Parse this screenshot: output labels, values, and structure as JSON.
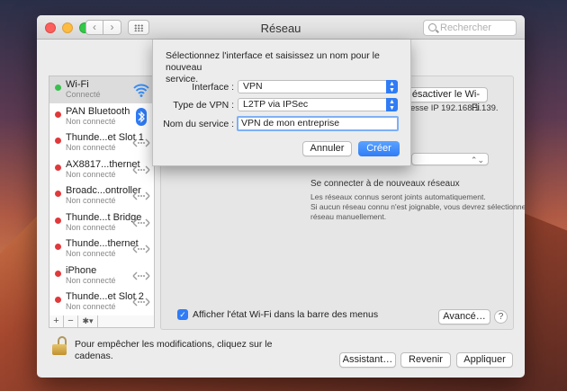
{
  "window": {
    "title": "Réseau",
    "search_placeholder": "Rechercher",
    "nav_back": "‹",
    "nav_forward": "›"
  },
  "sidebar": {
    "items": [
      {
        "name": "Wi-Fi",
        "status": "Connecté",
        "dot": "green",
        "icon": "wifi-icon"
      },
      {
        "name": "PAN Bluetooth",
        "status": "Non connecté",
        "dot": "red",
        "icon": "bluetooth-icon"
      },
      {
        "name": "Thunde...et Slot 1",
        "status": "Non connecté",
        "dot": "red",
        "icon": "ethernet-icon"
      },
      {
        "name": "AX8817...thernet",
        "status": "Non connecté",
        "dot": "red",
        "icon": "ethernet-icon"
      },
      {
        "name": "Broadc...ontroller",
        "status": "Non connecté",
        "dot": "red",
        "icon": "ethernet-icon"
      },
      {
        "name": "Thunde...t Bridge",
        "status": "Non connecté",
        "dot": "red",
        "icon": "ethernet-icon"
      },
      {
        "name": "Thunde...thernet",
        "status": "Non connecté",
        "dot": "red",
        "icon": "ethernet-icon"
      },
      {
        "name": "iPhone",
        "status": "Non connecté",
        "dot": "red",
        "icon": "ethernet-icon"
      },
      {
        "name": "Thunde...et Slot 2",
        "status": "Non connecté",
        "dot": "red",
        "icon": "ethernet-icon"
      }
    ],
    "add_label": "+",
    "remove_label": "−",
    "action_label": "✱▾"
  },
  "pane": {
    "disable_wifi_label": "ésactiver le Wi-Fi",
    "ip_text": "esse IP 192.168.1.139.",
    "ask_join_label": "Se connecter à de nouveaux réseaux",
    "auto_join_help": "Les réseaux connus seront joints automatiquement.",
    "no_network_help_1": "Si aucun réseau connu n'est joignable, vous devrez sélectionner un",
    "no_network_help_2": "réseau manuellement.",
    "show_status_label": "Afficher l'état Wi-Fi dans la barre des menus",
    "show_status_checked": true,
    "advanced_label": "Avancé…",
    "help_label": "?"
  },
  "footer": {
    "lock_text_1": "Pour empêcher les modifications, cliquez sur le",
    "lock_text_2": "cadenas.",
    "assistant_label": "Assistant…",
    "revert_label": "Revenir",
    "apply_label": "Appliquer"
  },
  "sheet": {
    "message_1": "Sélectionnez l'interface et saisissez un nom pour le nouveau",
    "message_2": "service.",
    "interface_label": "Interface :",
    "interface_value": "VPN",
    "vpn_type_label": "Type de VPN :",
    "vpn_type_value": "L2TP via IPSec",
    "service_name_label": "Nom du service :",
    "service_name_value": "VPN de mon entreprise",
    "cancel_label": "Annuler",
    "create_label": "Créer"
  },
  "colors": {
    "accent": "#2f7cf6",
    "connected": "#39c04e",
    "disconnected": "#e0393b"
  }
}
